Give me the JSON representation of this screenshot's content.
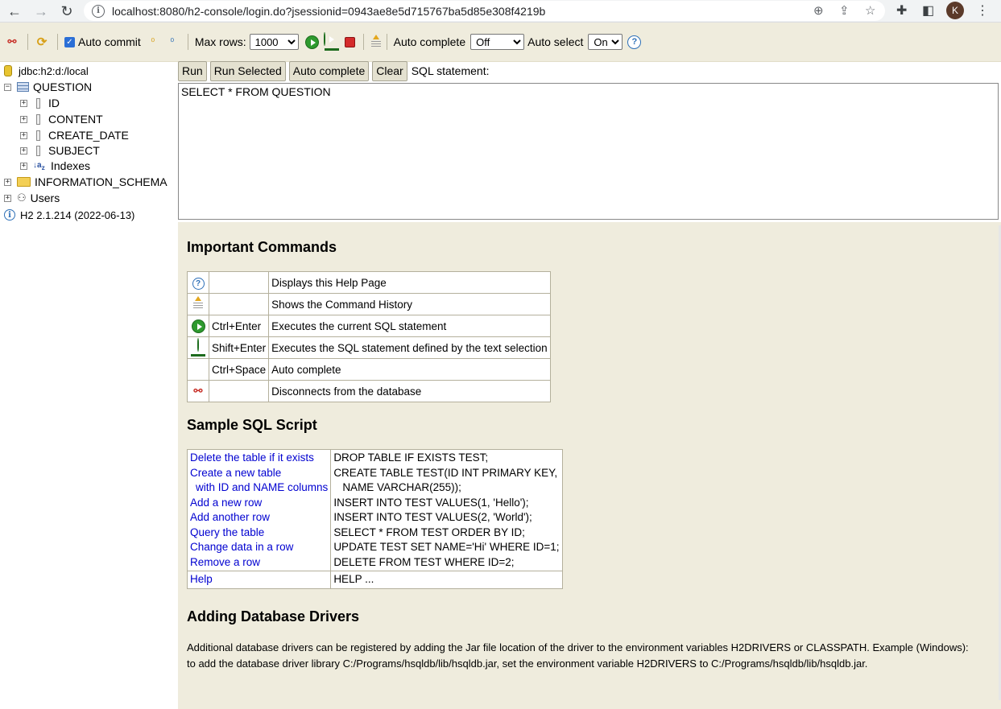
{
  "browser": {
    "url": "localhost:8080/h2-console/login.do?jsessionid=0943ae8e5d715767ba5d85e308f4219b",
    "profile_initial": "K"
  },
  "toolbar": {
    "auto_commit_label": "Auto commit",
    "max_rows_label": "Max rows:",
    "max_rows_value": "1000",
    "auto_complete_label": "Auto complete",
    "auto_complete_value": "Off",
    "auto_select_label": "Auto select",
    "auto_select_value": "On"
  },
  "tree": {
    "connection": "jdbc:h2:d:/local",
    "table": "QUESTION",
    "columns": [
      "ID",
      "CONTENT",
      "CREATE_DATE",
      "SUBJECT"
    ],
    "indexes": "Indexes",
    "schema": "INFORMATION_SCHEMA",
    "users": "Users",
    "version": "H2 2.1.214 (2022-06-13)"
  },
  "query": {
    "run": "Run",
    "run_selected": "Run Selected",
    "auto_complete": "Auto complete",
    "clear": "Clear",
    "sql_label": "SQL statement:",
    "sql_text": "SELECT * FROM QUESTION"
  },
  "help": {
    "important_title": "Important Commands",
    "commands": [
      {
        "icon": "help-icon",
        "key": "",
        "desc": "Displays this Help Page"
      },
      {
        "icon": "history-icon",
        "key": "",
        "desc": "Shows the Command History"
      },
      {
        "icon": "run-icon",
        "key": "Ctrl+Enter",
        "desc": "Executes the current SQL statement"
      },
      {
        "icon": "run-selected-icon",
        "key": "Shift+Enter",
        "desc": "Executes the SQL statement defined by the text selection"
      },
      {
        "icon": "",
        "key": "Ctrl+Space",
        "desc": "Auto complete"
      },
      {
        "icon": "disconnect-icon",
        "key": "",
        "desc": "Disconnects from the database"
      }
    ],
    "sample_title": "Sample SQL Script",
    "sample_links": [
      "Delete the table if it exists",
      "Create a new table",
      "with ID and NAME columns",
      "Add a new row",
      "Add another row",
      "Query the table",
      "Change data in a row",
      "Remove a row"
    ],
    "sample_sql": [
      "DROP TABLE IF EXISTS TEST;",
      "CREATE TABLE TEST(ID INT PRIMARY KEY,",
      "NAME VARCHAR(255));",
      "INSERT INTO TEST VALUES(1, 'Hello');",
      "INSERT INTO TEST VALUES(2, 'World');",
      "SELECT * FROM TEST ORDER BY ID;",
      "UPDATE TEST SET NAME='Hi' WHERE ID=1;",
      "DELETE FROM TEST WHERE ID=2;"
    ],
    "help_link": "Help",
    "help_sql": "HELP ...",
    "drivers_title": "Adding Database Drivers",
    "drivers_text_1": "Additional database drivers can be registered by adding the Jar file location of the driver to the environment variables H2DRIVERS or CLASSPATH. Example (Windows):",
    "drivers_text_2": "to add the database driver library C:/Programs/hsqldb/lib/hsqldb.jar, set the environment variable H2DRIVERS to C:/Programs/hsqldb/lib/hsqldb.jar."
  }
}
